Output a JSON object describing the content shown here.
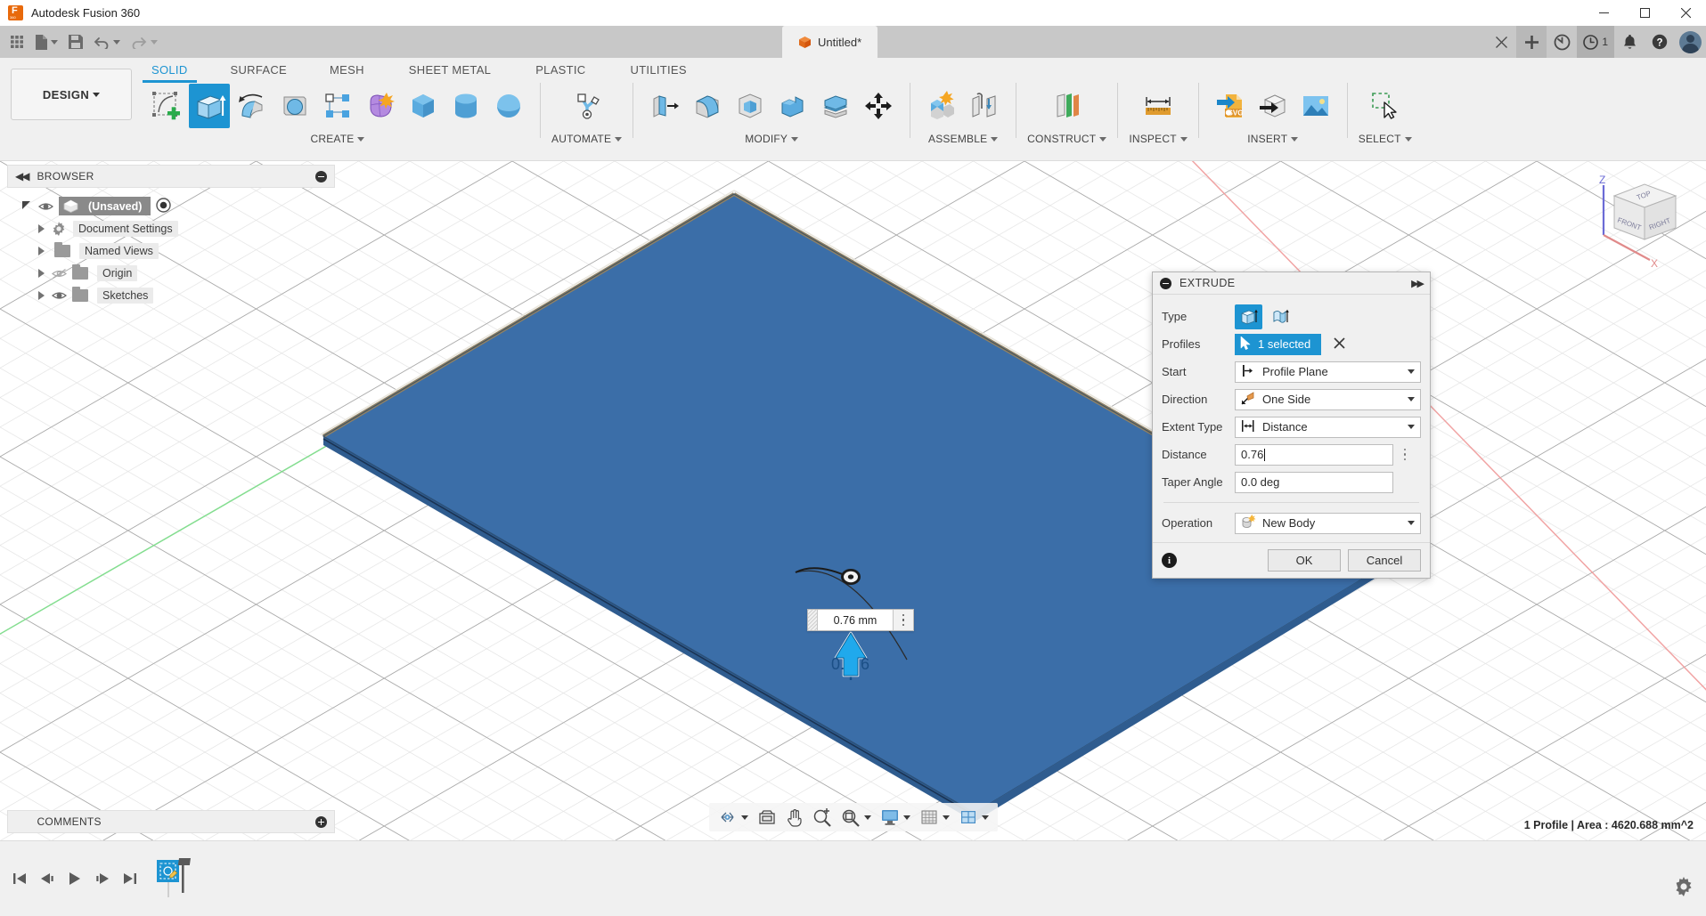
{
  "window": {
    "title": "Autodesk Fusion 360",
    "app_icon": "fusion-logo-icon",
    "controls": {
      "minimize": "—",
      "maximize": "☐",
      "close": "✕"
    }
  },
  "quick_access": {
    "items": [
      {
        "name": "app-grid-icon",
        "label": ""
      },
      {
        "name": "new-document-icon",
        "label": "",
        "has_caret": true
      },
      {
        "name": "save-icon",
        "label": ""
      },
      {
        "name": "undo-icon",
        "label": "",
        "has_caret": true
      },
      {
        "name": "redo-icon",
        "label": "",
        "has_caret": true
      }
    ]
  },
  "document_tab": {
    "label": "Untitled*",
    "icon": "orange-cube-icon",
    "close": "✕"
  },
  "tabstrip_right": {
    "add_tab": "+",
    "history_icon": "job-status-icon",
    "recent_count": "1",
    "notifications_icon": "bell-icon",
    "help_icon": "help-icon",
    "avatar": "user-avatar"
  },
  "ribbon": {
    "workspace": {
      "label": "DESIGN"
    },
    "tabs": [
      {
        "label": "SOLID",
        "active": true
      },
      {
        "label": "SURFACE",
        "active": false
      },
      {
        "label": "MESH",
        "active": false
      },
      {
        "label": "SHEET METAL",
        "active": false
      },
      {
        "label": "PLASTIC",
        "active": false
      },
      {
        "label": "UTILITIES",
        "active": false
      }
    ],
    "panels": [
      {
        "label": "CREATE",
        "tools": [
          {
            "name": "create-sketch-icon",
            "selected": false
          },
          {
            "name": "extrude-icon",
            "selected": true
          },
          {
            "name": "revolve-icon",
            "selected": false
          },
          {
            "name": "sweep-icon",
            "selected": false
          },
          {
            "name": "pattern-icon",
            "selected": false
          },
          {
            "name": "create-form-icon",
            "selected": false
          },
          {
            "name": "box-icon",
            "selected": false
          },
          {
            "name": "cylinder-icon",
            "selected": false
          },
          {
            "name": "sphere-icon",
            "selected": false
          }
        ]
      },
      {
        "label": "AUTOMATE",
        "tools": [
          {
            "name": "automate-icon",
            "selected": false
          }
        ]
      },
      {
        "label": "MODIFY",
        "tools": [
          {
            "name": "press-pull-icon",
            "selected": false
          },
          {
            "name": "fillet-icon",
            "selected": false
          },
          {
            "name": "shell-icon",
            "selected": false
          },
          {
            "name": "combine-icon",
            "selected": false
          },
          {
            "name": "split-body-icon",
            "selected": false
          },
          {
            "name": "move-copy-icon",
            "selected": false
          }
        ]
      },
      {
        "label": "ASSEMBLE",
        "tools": [
          {
            "name": "new-component-icon",
            "selected": false
          },
          {
            "name": "joint-icon",
            "selected": false
          }
        ]
      },
      {
        "label": "CONSTRUCT",
        "tools": [
          {
            "name": "offset-plane-icon",
            "selected": false
          }
        ]
      },
      {
        "label": "INSPECT",
        "tools": [
          {
            "name": "measure-icon",
            "selected": false
          }
        ]
      },
      {
        "label": "INSERT",
        "tools": [
          {
            "name": "insert-svg-icon",
            "selected": false
          },
          {
            "name": "insert-derive-icon",
            "selected": false
          },
          {
            "name": "canvas-image-icon",
            "selected": false
          }
        ]
      },
      {
        "label": "SELECT",
        "tools": [
          {
            "name": "select-cursor-icon",
            "selected": false
          }
        ]
      }
    ]
  },
  "browser": {
    "header": {
      "title": "BROWSER",
      "collapse_icon": "collapse-left-icon",
      "minimize_icon": "minimize-icon"
    },
    "items": [
      {
        "label": "(Unsaved)",
        "icon": "component-icon",
        "eye": "visible",
        "indent": 0,
        "root": true,
        "radio": true
      },
      {
        "label": "Document Settings",
        "icon": "gear-icon",
        "eye": "none",
        "indent": 1
      },
      {
        "label": "Named Views",
        "icon": "folder-icon",
        "eye": "none",
        "indent": 1
      },
      {
        "label": "Origin",
        "icon": "folder-icon",
        "eye": "hidden",
        "indent": 1
      },
      {
        "label": "Sketches",
        "icon": "folder-icon",
        "eye": "visible",
        "indent": 1
      }
    ]
  },
  "canvas": {
    "dimension_input": {
      "value": "0.76 mm",
      "grip": "drag-grip",
      "menu": "kebab-menu"
    },
    "manipulator_label": "0.76",
    "viewcube": {
      "faces": [
        "TOP",
        "FRONT",
        "RIGHT"
      ],
      "axes": [
        "Z",
        "X"
      ]
    },
    "body_color": "#3b6ea8",
    "body_edge_color": "#6b6248"
  },
  "dialog": {
    "title": "EXTRUDE",
    "collapse_icon": "minimize-icon",
    "expand_icon": "expand-right-icon",
    "rows": [
      {
        "label": "Type",
        "kind": "icon-toggle",
        "options": [
          "extrude-solid-icon",
          "extrude-thin-icon"
        ],
        "selected_index": 0
      },
      {
        "label": "Profiles",
        "kind": "selection",
        "value": "1 selected",
        "icon": "cursor-icon",
        "clear": "✕"
      },
      {
        "label": "Start",
        "kind": "dropdown",
        "value": "Profile Plane",
        "icon": "profile-plane-icon"
      },
      {
        "label": "Direction",
        "kind": "dropdown",
        "value": "One Side",
        "icon": "one-side-icon"
      },
      {
        "label": "Extent Type",
        "kind": "dropdown",
        "value": "Distance",
        "icon": "distance-icon"
      },
      {
        "label": "Distance",
        "kind": "text",
        "value": "0.76",
        "menu": "kebab-menu"
      },
      {
        "label": "Taper Angle",
        "kind": "text",
        "value": "0.0 deg"
      },
      {
        "label": "Operation",
        "kind": "dropdown",
        "value": "New Body",
        "icon": "new-body-icon"
      }
    ],
    "footer": {
      "info_icon": "info-icon",
      "ok": "OK",
      "cancel": "Cancel"
    }
  },
  "navbar": {
    "items": [
      {
        "name": "orbit-icon",
        "caret": true
      },
      {
        "name": "look-at-icon",
        "caret": false
      },
      {
        "name": "pan-icon",
        "caret": false
      },
      {
        "name": "zoom-icon",
        "caret": false
      },
      {
        "name": "fit-icon",
        "caret": true
      },
      {
        "name": "display-settings-icon",
        "caret": true
      },
      {
        "name": "grid-snaps-icon",
        "caret": true
      },
      {
        "name": "viewports-icon",
        "caret": true
      }
    ]
  },
  "comments": {
    "title": "COMMENTS",
    "add_icon": "add-comment-icon"
  },
  "status_bar": {
    "text": "1 Profile | Area : 4620.688 mm^2"
  },
  "timeline": {
    "buttons": [
      "go-to-beginning-icon",
      "step-back-icon",
      "play-icon",
      "step-forward-icon",
      "go-to-end-icon"
    ],
    "features": [
      {
        "name": "sketch-feature-icon"
      }
    ],
    "settings_icon": "settings-gear-icon"
  }
}
